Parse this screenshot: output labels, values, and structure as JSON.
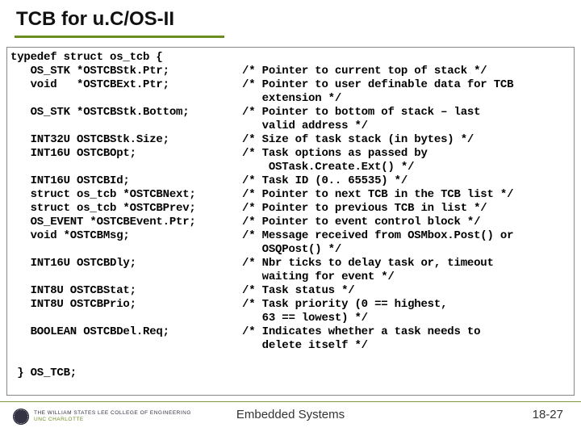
{
  "title": "TCB for u.C/OS-II",
  "code": "typedef struct os_tcb {\n   OS_STK *OSTCBStk.Ptr;           /* Pointer to current top of stack */\n   void   *OSTCBExt.Ptr;           /* Pointer to user definable data for TCB\n                                      extension */\n   OS_STK *OSTCBStk.Bottom;        /* Pointer to bottom of stack – last\n                                      valid address */\n   INT32U OSTCBStk.Size;           /* Size of task stack (in bytes) */\n   INT16U OSTCBOpt;                /* Task options as passed by\n                                       OSTask.Create.Ext() */\n   INT16U OSTCBId;                 /* Task ID (0.. 65535) */\n   struct os_tcb *OSTCBNext;       /* Pointer to next TCB in the TCB list */\n   struct os_tcb *OSTCBPrev;       /* Pointer to previous TCB in list */\n   OS_EVENT *OSTCBEvent.Ptr;       /* Pointer to event control block */\n   void *OSTCBMsg;                 /* Message received from OSMbox.Post() or\n                                      OSQPost() */\n   INT16U OSTCBDly;                /* Nbr ticks to delay task or, timeout\n                                      waiting for event */\n   INT8U OSTCBStat;                /* Task status */\n   INT8U OSTCBPrio;                /* Task priority (0 == highest,\n                                      63 == lowest) */\n   BOOLEAN OSTCBDel.Req;           /* Indicates whether a task needs to\n                                      delete itself */\n\n } OS_TCB;",
  "footer": {
    "center": "Embedded Systems",
    "right": "18-27",
    "logo_line1": "THE WILLIAM STATES LEE COLLEGE OF ENGINEERING",
    "logo_line2": "UNC CHARLOTTE"
  }
}
